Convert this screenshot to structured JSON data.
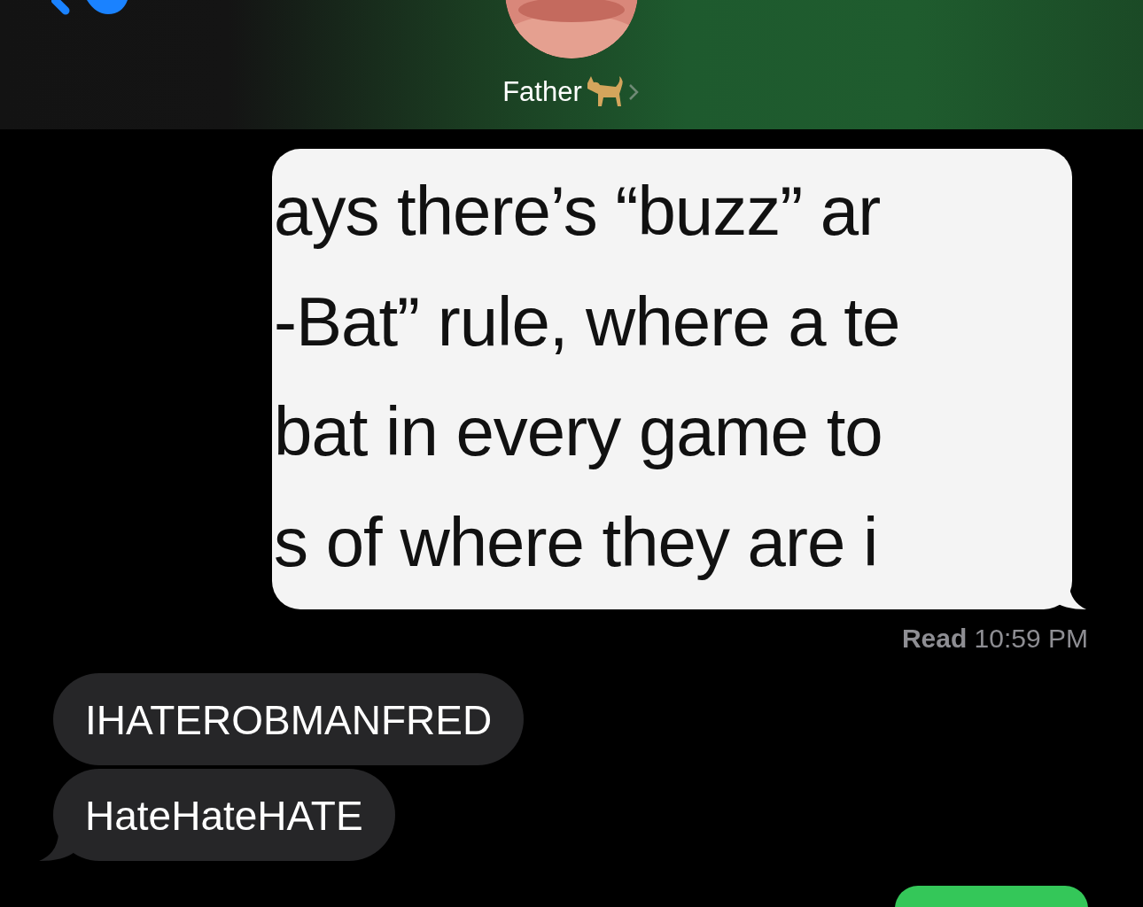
{
  "header": {
    "contact_name": "Father"
  },
  "messages": [
    {
      "kind": "image",
      "from_me": true,
      "lines": [
        "ays there’s “buzz” ar",
        "-Bat” rule, where a te",
        "bat in every game to",
        "s of where they are i"
      ]
    },
    {
      "kind": "receipt",
      "text": "**Read** 10:59 PM"
    },
    {
      "kind": "text",
      "from_me": false,
      "text": "IHATEROBMANFRED",
      "tail": false
    },
    {
      "kind": "text",
      "from_me": false,
      "text": "HateHateHATE",
      "tail": true
    },
    {
      "kind": "blank",
      "from_me": true
    }
  ]
}
